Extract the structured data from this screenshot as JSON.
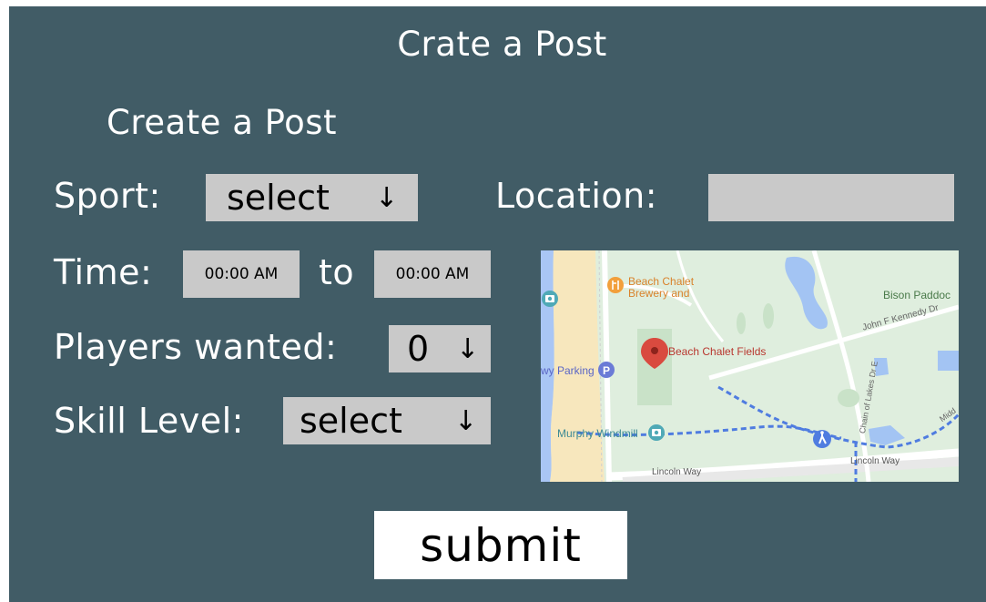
{
  "header": {
    "title": "Crate a Post"
  },
  "form": {
    "heading": "Create a Post",
    "sport": {
      "label": "Sport:",
      "value": "select",
      "arrow": "↓"
    },
    "location": {
      "label": "Location:",
      "value": ""
    },
    "time": {
      "label": "Time:",
      "start": "00:00 AM",
      "separator": "to",
      "end": "00:00 AM"
    },
    "players": {
      "label": "Players wanted:",
      "value": "0",
      "arrow": "↓"
    },
    "skill": {
      "label": "Skill Level:",
      "value": "select",
      "arrow": "↓"
    },
    "submit_label": "submit"
  },
  "map": {
    "labels": {
      "brewery_line1": "Beach Chalet",
      "brewery_line2": "Brewery and",
      "bison": "Bison Paddoc",
      "jfk": "John F Kennedy Dr",
      "fields": "Beach Chalet Fields",
      "parking": "wy Parking",
      "windmill": "Murphy Windmill",
      "chain": "Chain of Lakes Dr E",
      "lincoln1": "Lincoln Way",
      "lincoln2": "Lincoln Way",
      "middle": "Midd"
    },
    "colors": {
      "park": "#dfeede",
      "water": "#a3c4f3",
      "beach": "#f7e7bd",
      "ocean": "#a9c6f5",
      "road": "#ffffff",
      "trail": "#4f7ce0",
      "pin": "#d94a3f"
    }
  }
}
